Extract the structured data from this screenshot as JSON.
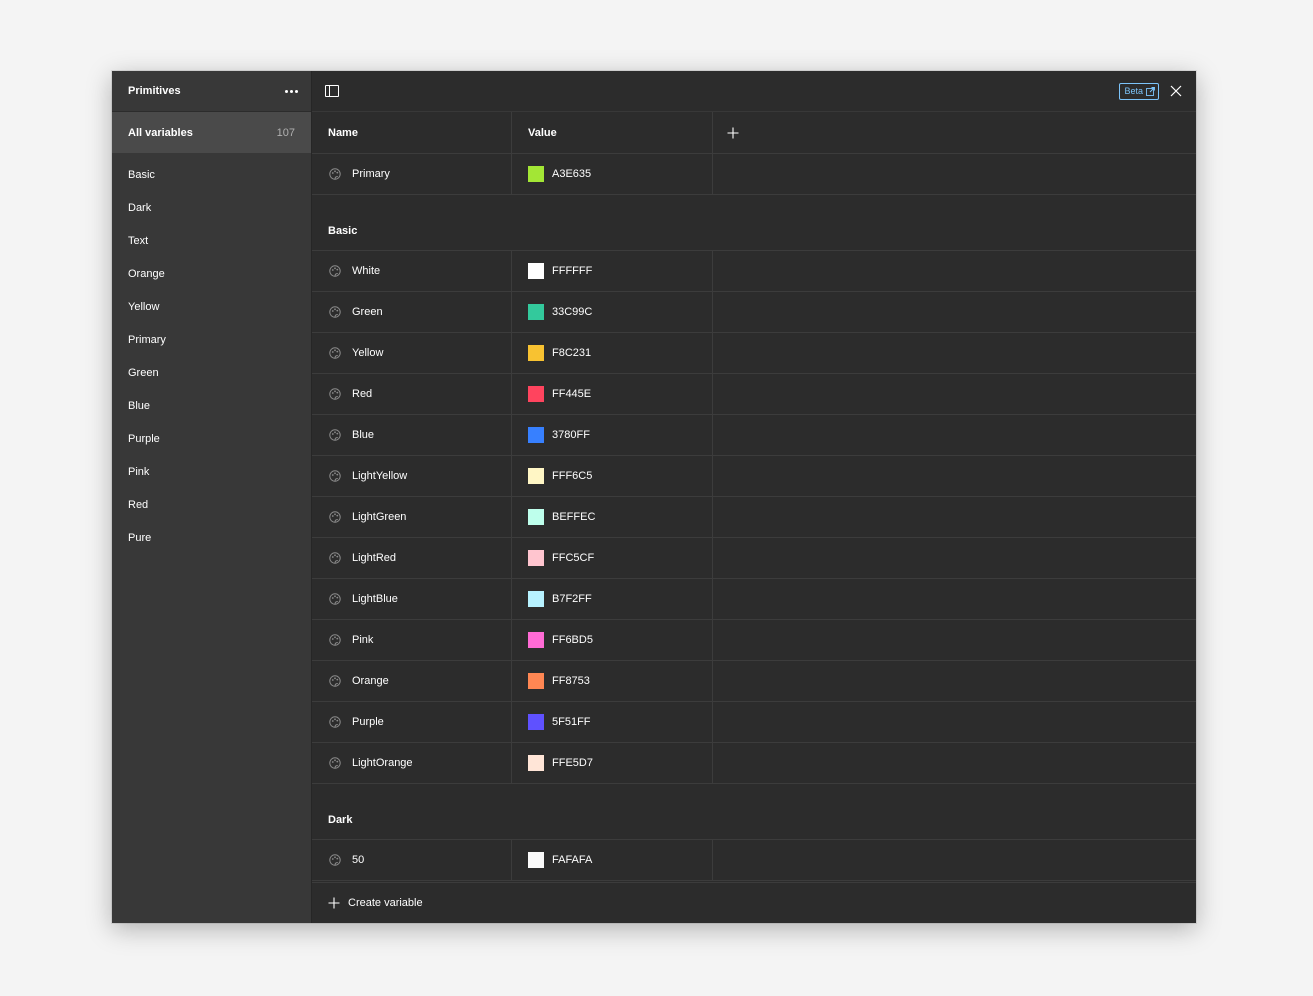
{
  "sidebar": {
    "title": "Primitives",
    "all_variables": {
      "label": "All variables",
      "count": "107"
    },
    "groups": [
      "Basic",
      "Dark",
      "Text",
      "Orange",
      "Yellow",
      "Primary",
      "Green",
      "Blue",
      "Purple",
      "Pink",
      "Red",
      "Pure"
    ]
  },
  "topbar": {
    "beta_label": "Beta"
  },
  "table": {
    "headers": {
      "name": "Name",
      "value": "Value"
    },
    "ungrouped": [
      {
        "name": "Primary",
        "value": "A3E635",
        "color": "#A3E635"
      }
    ],
    "basic_group": {
      "title": "Basic",
      "rows": [
        {
          "name": "White",
          "value": "FFFFFF",
          "color": "#FFFFFF"
        },
        {
          "name": "Green",
          "value": "33C99C",
          "color": "#33C99C"
        },
        {
          "name": "Yellow",
          "value": "F8C231",
          "color": "#F8C231"
        },
        {
          "name": "Red",
          "value": "FF445E",
          "color": "#FF445E"
        },
        {
          "name": "Blue",
          "value": "3780FF",
          "color": "#3780FF"
        },
        {
          "name": "LightYellow",
          "value": "FFF6C5",
          "color": "#FFF6C5"
        },
        {
          "name": "LightGreen",
          "value": "BEFFEC",
          "color": "#BEFFEC"
        },
        {
          "name": "LightRed",
          "value": "FFC5CF",
          "color": "#FFC5CF"
        },
        {
          "name": "LightBlue",
          "value": "B7F2FF",
          "color": "#B7F2FF"
        },
        {
          "name": "Pink",
          "value": "FF6BD5",
          "color": "#FF6BD5"
        },
        {
          "name": "Orange",
          "value": "FF8753",
          "color": "#FF8753"
        },
        {
          "name": "Purple",
          "value": "5F51FF",
          "color": "#5F51FF"
        },
        {
          "name": "LightOrange",
          "value": "FFE5D7",
          "color": "#FFE5D7"
        }
      ]
    },
    "dark_group": {
      "title": "Dark",
      "rows": [
        {
          "name": "50",
          "value": "FAFAFA",
          "color": "#FAFAFA"
        }
      ]
    }
  },
  "footer": {
    "create_label": "Create variable"
  }
}
